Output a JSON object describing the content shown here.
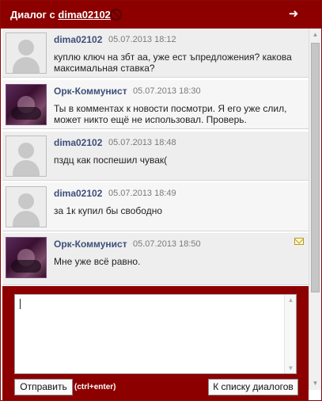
{
  "header": {
    "title_prefix": "Диалог с",
    "username": "dima02102"
  },
  "messages": [
    {
      "author": "dima02102",
      "time": "05.07.2013 18:12",
      "text": "куплю ключ на збт аа, уже ест ъпредложения? какова максимальная ставка?",
      "avatar": "default"
    },
    {
      "author": "Орк-Коммунист",
      "time": "05.07.2013 18:30",
      "text": "Ты в комментах к новости посмотри. Я его уже слил, может никто ещё не использовал. Проверь.",
      "avatar": "photo"
    },
    {
      "author": "dima02102",
      "time": "05.07.2013 18:48",
      "text": "пздц как поспешил чувак(",
      "avatar": "default"
    },
    {
      "author": "dima02102",
      "time": "05.07.2013 18:49",
      "text": "за 1к купил бы свободно",
      "avatar": "default"
    },
    {
      "author": "Орк-Коммунист",
      "time": "05.07.2013 18:50",
      "text": "Мне уже всё равно.",
      "avatar": "photo"
    }
  ],
  "composer": {
    "value": "",
    "send_label": "Отправить",
    "hint": "(ctrl+enter)",
    "dialog_list_label": "К списку диалогов"
  },
  "colors": {
    "brand": "#8c0000",
    "author": "#3d4f7a"
  },
  "icons": {
    "block": "block-icon",
    "exit": "exit-arrow-icon",
    "unread": "envelope-icon"
  }
}
